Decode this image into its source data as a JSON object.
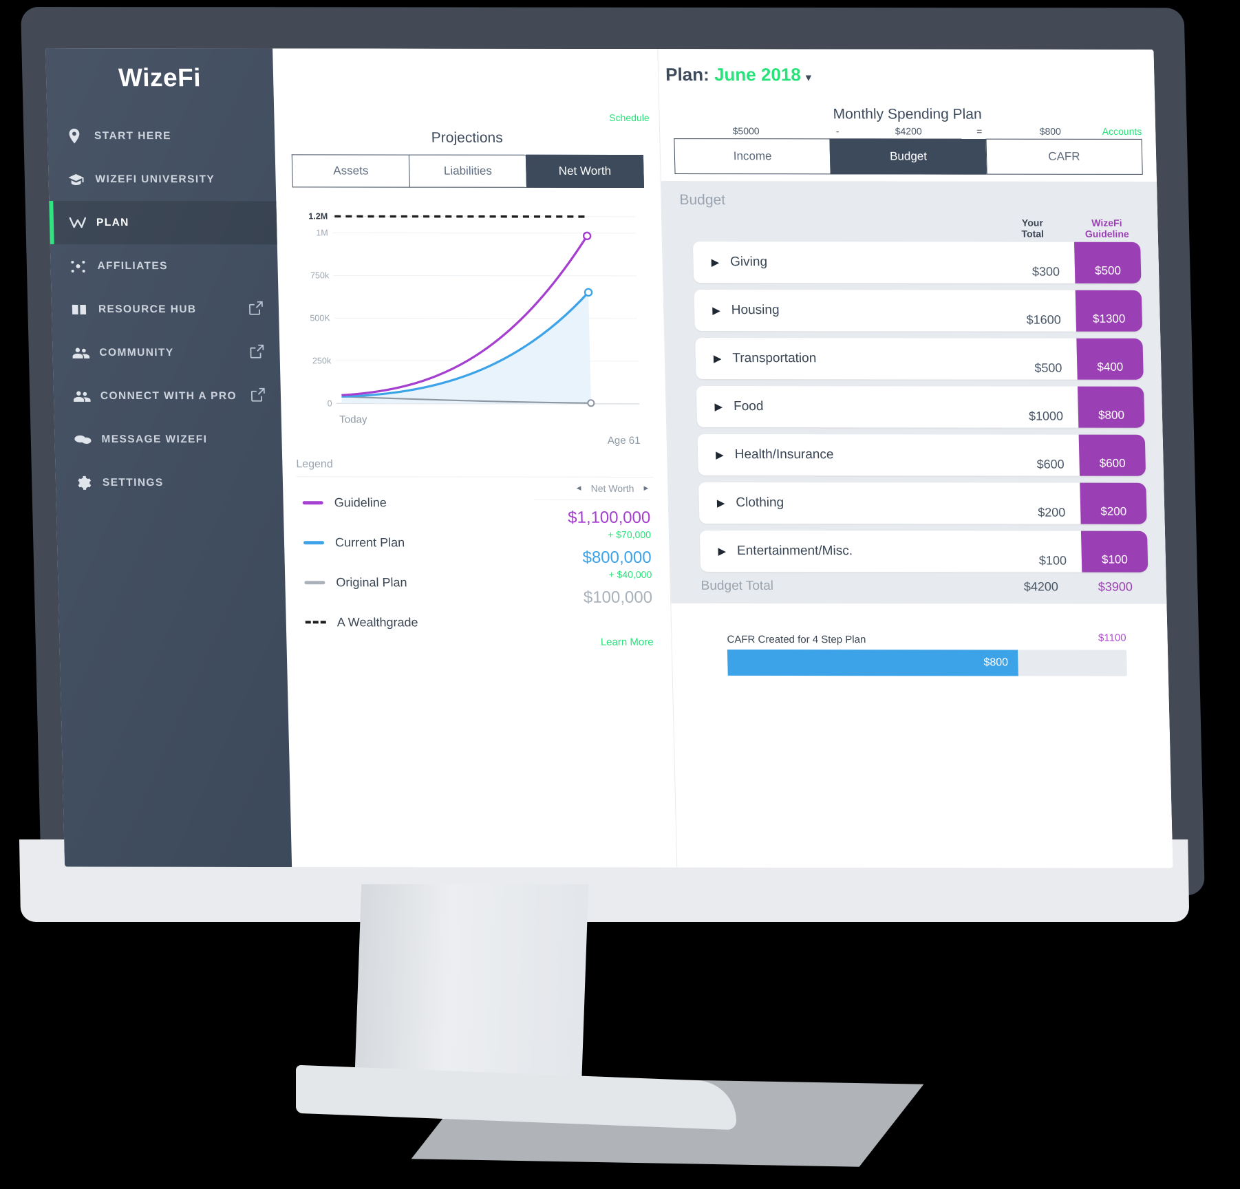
{
  "brand": "WizeFi",
  "sidebar": {
    "items": [
      {
        "label": "START HERE",
        "icon": "location-pin-icon",
        "external": false,
        "active": false
      },
      {
        "label": "WIZEFI UNIVERSITY",
        "icon": "graduation-cap-icon",
        "external": false,
        "active": false
      },
      {
        "label": "PLAN",
        "icon": "wizefi-w-icon",
        "external": false,
        "active": true
      },
      {
        "label": "AFFILIATES",
        "icon": "network-nodes-icon",
        "external": false,
        "active": false
      },
      {
        "label": "RESOURCE HUB",
        "icon": "book-icon",
        "external": true,
        "active": false
      },
      {
        "label": "COMMUNITY",
        "icon": "people-icon",
        "external": true,
        "active": false
      },
      {
        "label": "CONNECT WITH A PRO",
        "icon": "people-icon",
        "external": true,
        "active": false
      },
      {
        "label": "MESSAGE WIZEFI",
        "icon": "chat-bubbles-icon",
        "external": false,
        "active": false
      },
      {
        "label": "SETTINGS",
        "icon": "gear-icon",
        "external": false,
        "active": false
      }
    ]
  },
  "projections": {
    "title": "Projections",
    "schedule_link": "Schedule",
    "tabs": [
      {
        "label": "Assets",
        "active": false
      },
      {
        "label": "Liabilities",
        "active": false
      },
      {
        "label": "Net Worth",
        "active": true
      }
    ],
    "legend_header": "Legend",
    "net_worth_switch": {
      "label": "Net Worth",
      "prev": "◄",
      "next": "►"
    },
    "legend": [
      {
        "label": "Guideline",
        "color": "#a43fd0",
        "style": "solid",
        "value": "$1,100,000",
        "delta": "+ $70,000"
      },
      {
        "label": "Current Plan",
        "color": "#3da3e8",
        "style": "solid",
        "value": "$800,000",
        "delta": "+ $40,000"
      },
      {
        "label": "Original Plan",
        "color": "#a9b1bb",
        "style": "solid",
        "value": "$100,000",
        "delta": ""
      },
      {
        "label": "A Wealthgrade",
        "color": "#1d1d1d",
        "style": "dashed",
        "value": "",
        "delta": ""
      }
    ],
    "learn_more": "Learn More"
  },
  "chart_data": {
    "type": "line",
    "title": "Projections",
    "xlabel": "",
    "ylabel": "",
    "x": [
      "Today",
      "Age 61"
    ],
    "x_tick_labels": [
      "Today",
      "Age 61"
    ],
    "y_tick_labels": [
      "1.2M",
      "1M",
      "750k",
      "500K",
      "250k",
      "0"
    ],
    "y_tick_values": [
      1200000,
      1000000,
      750000,
      500000,
      250000,
      0
    ],
    "ylim": [
      0,
      1250000
    ],
    "grid": true,
    "legend_position": "below-chart",
    "series": [
      {
        "name": "Guideline",
        "color": "#a43fd0",
        "style": "solid",
        "start": 40000,
        "end": 1100000,
        "end_label": "$1,100,000"
      },
      {
        "name": "Current Plan",
        "color": "#3da3e8",
        "style": "solid",
        "fill": "#e8f3fb",
        "start": 40000,
        "end": 800000,
        "end_label": "$800,000"
      },
      {
        "name": "Original Plan",
        "color": "#8d97a3",
        "style": "solid",
        "start": 40000,
        "end": 100000,
        "end_label": "$100,000"
      },
      {
        "name": "A Wealthgrade",
        "color": "#1d1d1d",
        "style": "dashed",
        "start": 1200000,
        "end": 1200000,
        "end_label": ""
      }
    ]
  },
  "plan": {
    "label": "Plan:",
    "month": "June 2018",
    "caret": "▾"
  },
  "spending": {
    "title": "Monthly Spending Plan",
    "accounts_link": "Accounts",
    "income_amount": "$5000",
    "minus": "-",
    "budget_amount": "$4200",
    "equals": "=",
    "cafr_amount": "$800",
    "tabs": [
      {
        "label": "Income",
        "active": false
      },
      {
        "label": "Budget",
        "active": true
      },
      {
        "label": "CAFR",
        "active": false
      }
    ]
  },
  "budget": {
    "section_label": "Budget",
    "col_your_total": "Your\nTotal",
    "col_your_total_l1": "Your",
    "col_your_total_l2": "Total",
    "col_guideline_l1": "WizeFi",
    "col_guideline_l2": "Guideline",
    "rows": [
      {
        "name": "Giving",
        "your_total": "$300",
        "guideline": "$500"
      },
      {
        "name": "Housing",
        "your_total": "$1600",
        "guideline": "$1300"
      },
      {
        "name": "Transportation",
        "your_total": "$500",
        "guideline": "$400"
      },
      {
        "name": "Food",
        "your_total": "$1000",
        "guideline": "$800"
      },
      {
        "name": "Health/Insurance",
        "your_total": "$600",
        "guideline": "$600"
      },
      {
        "name": "Clothing",
        "your_total": "$200",
        "guideline": "$200"
      },
      {
        "name": "Entertainment/Misc.",
        "your_total": "$100",
        "guideline": "$100"
      }
    ],
    "total_label": "Budget Total",
    "total_your": "$4200",
    "total_guideline": "$3900"
  },
  "cafr": {
    "label": "CAFR Created for 4 Step Plan",
    "filled_value": "$800",
    "cap_value": "$1100"
  },
  "colors": {
    "accent_green": "#27e37a",
    "purple": "#9b3fb5",
    "blue": "#3da3e8",
    "dark": "#3d4a5c"
  }
}
